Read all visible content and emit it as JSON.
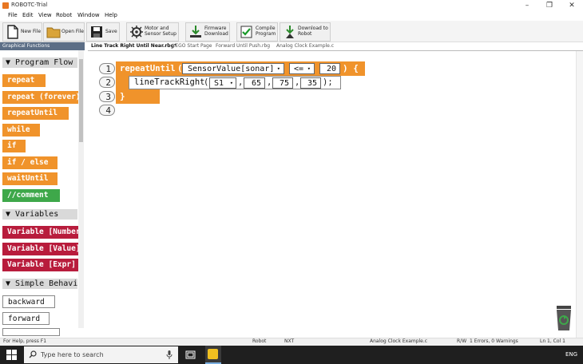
{
  "window": {
    "title": "ROBOTC-Trial",
    "controls": [
      "–",
      "❐",
      "✕"
    ]
  },
  "menu": [
    "File",
    "Edit",
    "View",
    "Robot",
    "Window",
    "Help"
  ],
  "toolbar": {
    "new_file": "New File",
    "open_file": "Open File",
    "save": "Save",
    "motor_setup_1": "Motor and",
    "motor_setup_2": "Sensor Setup",
    "firmware_1": "Firmware",
    "firmware_2": "Download",
    "compile_1": "Compile",
    "compile_2": "Program",
    "download_1": "Download to",
    "download_2": "Robot"
  },
  "left_panel": {
    "header": "Graphical Functions",
    "categories": [
      "▼ Program Flow",
      "▼ Variables",
      "▼ Simple Behavi"
    ],
    "program_flow": [
      "repeat",
      "repeat (forever)",
      "repeatUntil",
      "while",
      "if",
      "if / else",
      "waitUntil",
      "//comment"
    ],
    "variables": [
      "Variable [Number]",
      "Variable [Value]",
      "Variable [Expr]"
    ],
    "simple_behaviors": [
      "backward",
      "forward",
      ""
    ]
  },
  "tabs": [
    "Line Track Right Until Near.rbg*",
    "LEGO Start Page",
    "Forward Until Push.rbg",
    "Analog Clock Example.c"
  ],
  "code": {
    "line_numbers": [
      "1",
      "2",
      "3",
      "4"
    ],
    "repeat_until": "repeatUntil",
    "open_paren": "(",
    "sensor": "SensorValue[sonar]",
    "operator": "<=",
    "threshold": "20",
    "close_brace_open": ") {",
    "func": "lineTrackRight",
    "func_open": "(",
    "arg1": "S1",
    "comma": ",",
    "arg2": "65",
    "arg3": "75",
    "arg4": "35",
    "func_close": ");",
    "close_brace": "}"
  },
  "status": {
    "help": "For Help, press F1",
    "robot": "Robot",
    "platform": "NXT",
    "file": "Analog Clock Example.c",
    "mode": "R/W",
    "errors": "1 Errors, 0 Warnings",
    "position": "Ln 1, Col 1"
  },
  "taskbar": {
    "search_placeholder": "Type here to search",
    "lang": "ENG"
  },
  "colors": {
    "orange": "#f0932b",
    "green": "#3ea84a",
    "red": "#b81c3c",
    "header": "#5c6e86"
  }
}
